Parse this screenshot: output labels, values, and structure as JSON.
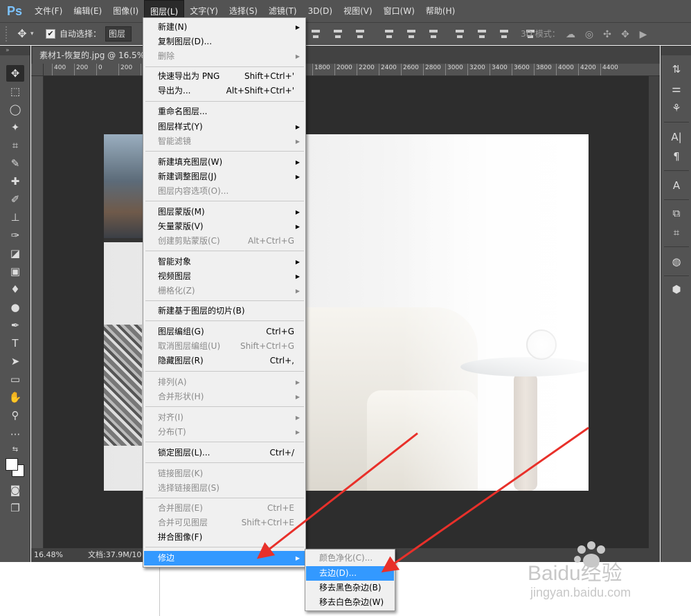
{
  "app": {
    "logo": "Ps",
    "menus": [
      "文件(F)",
      "编辑(E)",
      "图像(I)",
      "图层(L)",
      "文字(Y)",
      "选择(S)",
      "滤镜(T)",
      "3D(D)",
      "视图(V)",
      "窗口(W)",
      "帮助(H)"
    ],
    "active_menu_index": 3
  },
  "options": {
    "auto_select_label": "自动选择：",
    "auto_select_value": "图层",
    "mode_label": "3D 模式："
  },
  "document": {
    "tab_title": "素材1-恢复的.jpg @ 16.5%",
    "ruler_ticks": [
      "400",
      "200",
      "0",
      "200",
      "400",
      "1800",
      "2000",
      "2200",
      "2400",
      "2600",
      "2800",
      "3000",
      "3200",
      "3400",
      "3600",
      "3800",
      "4000",
      "4200",
      "4400"
    ],
    "zoom": "16.48%",
    "doc_size": "文档:37.9M/10"
  },
  "layer_menu": {
    "groups": [
      [
        {
          "label": "新建(N)",
          "submenu": true
        },
        {
          "label": "复制图层(D)..."
        },
        {
          "label": "删除",
          "disabled": true,
          "submenu": true
        }
      ],
      [
        {
          "label": "快速导出为 PNG",
          "shortcut": "Shift+Ctrl+'"
        },
        {
          "label": "导出为...",
          "shortcut": "Alt+Shift+Ctrl+'"
        }
      ],
      [
        {
          "label": "重命名图层..."
        },
        {
          "label": "图层样式(Y)",
          "submenu": true
        },
        {
          "label": "智能滤镜",
          "disabled": true,
          "submenu": true
        }
      ],
      [
        {
          "label": "新建填充图层(W)",
          "submenu": true
        },
        {
          "label": "新建调整图层(J)",
          "submenu": true
        },
        {
          "label": "图层内容选项(O)...",
          "disabled": true
        }
      ],
      [
        {
          "label": "图层蒙版(M)",
          "submenu": true
        },
        {
          "label": "矢量蒙版(V)",
          "submenu": true
        },
        {
          "label": "创建剪贴蒙版(C)",
          "disabled": true,
          "shortcut": "Alt+Ctrl+G"
        }
      ],
      [
        {
          "label": "智能对象",
          "submenu": true
        },
        {
          "label": "视频图层",
          "submenu": true
        },
        {
          "label": "栅格化(Z)",
          "disabled": true,
          "submenu": true
        }
      ],
      [
        {
          "label": "新建基于图层的切片(B)"
        }
      ],
      [
        {
          "label": "图层编组(G)",
          "shortcut": "Ctrl+G"
        },
        {
          "label": "取消图层编组(U)",
          "disabled": true,
          "shortcut": "Shift+Ctrl+G"
        },
        {
          "label": "隐藏图层(R)",
          "shortcut": "Ctrl+,"
        }
      ],
      [
        {
          "label": "排列(A)",
          "disabled": true,
          "submenu": true
        },
        {
          "label": "合并形状(H)",
          "disabled": true,
          "submenu": true
        }
      ],
      [
        {
          "label": "对齐(I)",
          "disabled": true,
          "submenu": true
        },
        {
          "label": "分布(T)",
          "disabled": true,
          "submenu": true
        }
      ],
      [
        {
          "label": "锁定图层(L)...",
          "shortcut": "Ctrl+/"
        }
      ],
      [
        {
          "label": "链接图层(K)",
          "disabled": true
        },
        {
          "label": "选择链接图层(S)",
          "disabled": true
        }
      ],
      [
        {
          "label": "合并图层(E)",
          "disabled": true,
          "shortcut": "Ctrl+E"
        },
        {
          "label": "合并可见图层",
          "disabled": true,
          "shortcut": "Shift+Ctrl+E"
        },
        {
          "label": "拼合图像(F)"
        }
      ],
      [
        {
          "label": "修边",
          "submenu": true,
          "highlighted": true
        }
      ]
    ]
  },
  "matting_submenu": [
    {
      "label": "颜色净化(C)...",
      "disabled": true
    },
    {
      "label": "去边(D)...",
      "highlighted": true
    },
    {
      "label": "移去黑色杂边(B)"
    },
    {
      "label": "移去白色杂边(W)"
    }
  ],
  "watermark": {
    "text": "Baidu经验",
    "url": "jingyan.baidu.com"
  },
  "colors": {
    "highlight": "#3399ff",
    "arrow": "#e8302a",
    "ps_panel": "#535353"
  }
}
